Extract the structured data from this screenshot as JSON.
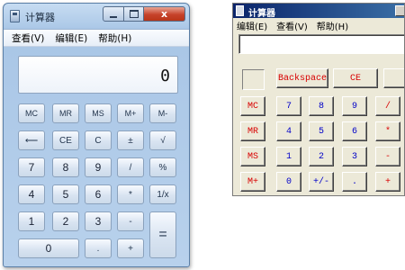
{
  "win7": {
    "title": "计算器",
    "menu": [
      "查看(V)",
      "编辑(E)",
      "帮助(H)"
    ],
    "close_glyph": "x",
    "display": "0",
    "rows": [
      [
        "MC",
        "MR",
        "MS",
        "M+",
        "M-"
      ],
      [
        "⟵",
        "CE",
        "C",
        "±",
        "√"
      ],
      [
        "7",
        "8",
        "9",
        "/",
        "%"
      ],
      [
        "4",
        "5",
        "6",
        "*",
        "1/x"
      ],
      [
        "1",
        "2",
        "3",
        "-",
        "="
      ],
      [
        "0",
        ".",
        "+"
      ]
    ]
  },
  "classic": {
    "title": "计算器",
    "menu": [
      "编辑(E)",
      "查看(V)",
      "帮助(H)"
    ],
    "top_buttons": [
      "Backspace",
      "CE"
    ],
    "rows": [
      [
        "MC",
        "7",
        "8",
        "9",
        "/"
      ],
      [
        "MR",
        "4",
        "5",
        "6",
        "*"
      ],
      [
        "MS",
        "1",
        "2",
        "3",
        "-"
      ],
      [
        "M+",
        "0",
        "+/-",
        ".",
        "+"
      ]
    ]
  },
  "colors": {
    "red_label": "#d80000",
    "blue_label": "#0000c8",
    "xp_face": "#ece9d8"
  }
}
